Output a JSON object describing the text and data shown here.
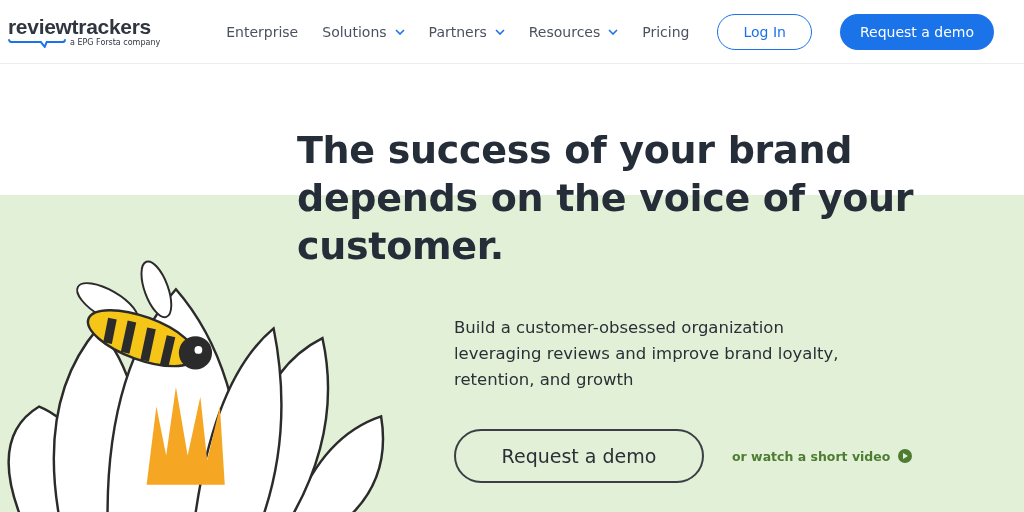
{
  "header": {
    "logo": {
      "wordmark": "reviewtrackers",
      "tagline": "a EPG Forsta company"
    },
    "nav": [
      {
        "label": "Enterprise",
        "has_menu": false
      },
      {
        "label": "Solutions",
        "has_menu": true
      },
      {
        "label": "Partners",
        "has_menu": true
      },
      {
        "label": "Resources",
        "has_menu": true
      },
      {
        "label": "Pricing",
        "has_menu": false
      }
    ],
    "login": "Log In",
    "cta": "Request a demo"
  },
  "hero": {
    "headline": "The success of your brand depends on the voice of your customer.",
    "subtitle": "Build a customer-obsessed organization leveraging reviews and improve brand loyalty, retention, and growth",
    "cta": "Request a demo",
    "video_link": "or watch a short video"
  }
}
